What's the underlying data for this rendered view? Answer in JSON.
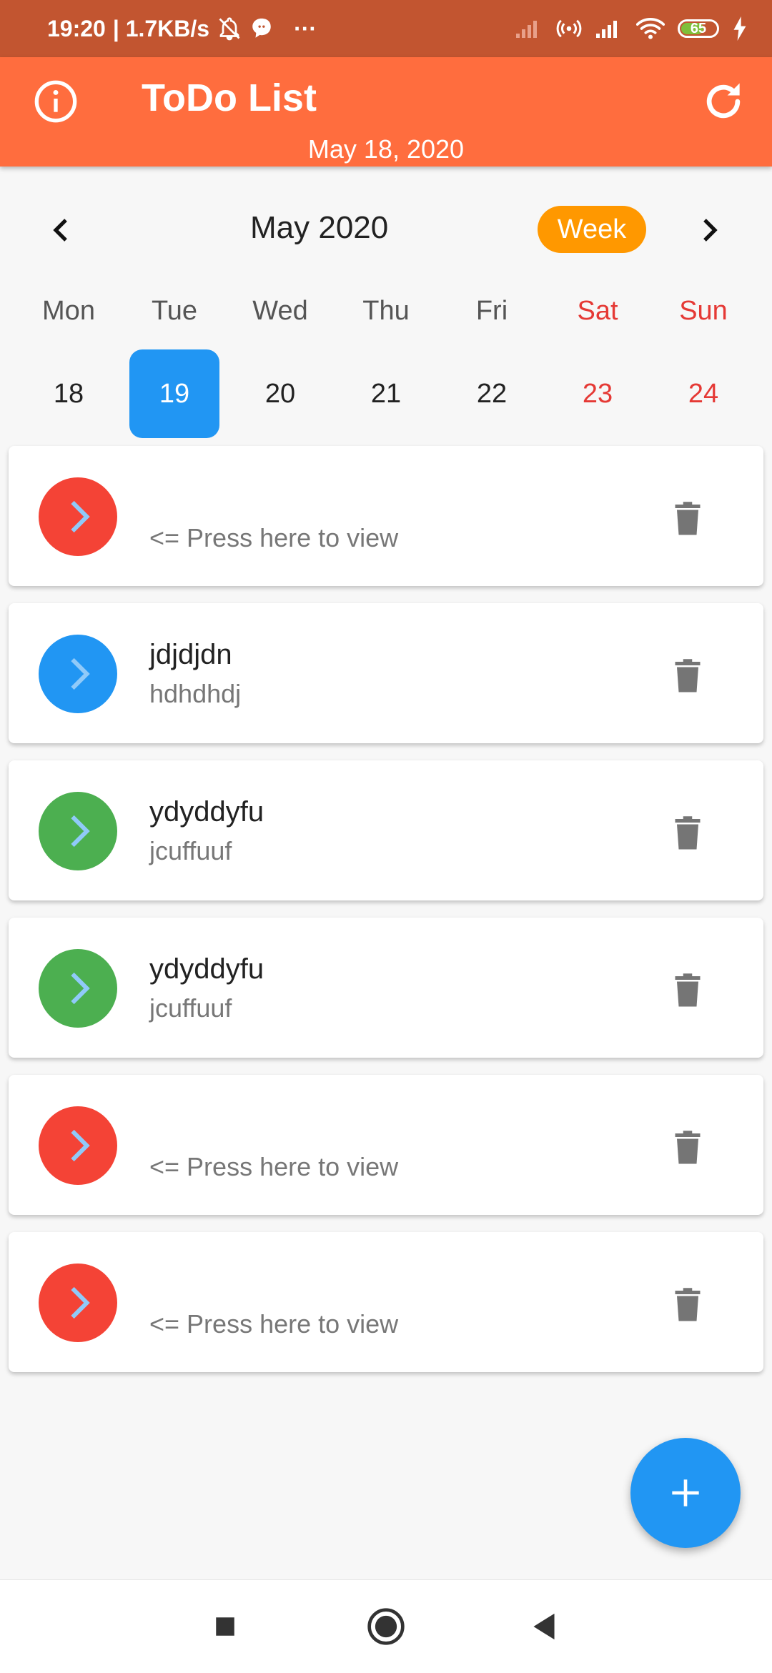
{
  "status_bar": {
    "time": "19:20",
    "net_speed": "| 1.7KB/s",
    "more": "···",
    "battery": "65"
  },
  "app_bar": {
    "title": "ToDo List",
    "date": "May 18, 2020"
  },
  "calendar": {
    "month": "May 2020",
    "view_toggle": "Week",
    "days": [
      {
        "name": "Mon",
        "num": "18"
      },
      {
        "name": "Tue",
        "num": "19",
        "selected": true
      },
      {
        "name": "Wed",
        "num": "20"
      },
      {
        "name": "Thu",
        "num": "21"
      },
      {
        "name": "Fri",
        "num": "22"
      },
      {
        "name": "Sat",
        "num": "23",
        "weekend": true
      },
      {
        "name": "Sun",
        "num": "24",
        "weekend": true
      }
    ]
  },
  "todos": [
    {
      "title": "",
      "subtitle": "<= Press here to view",
      "color": "#f44336"
    },
    {
      "title": "jdjdjdn",
      "subtitle": "hdhdhdj",
      "color": "#2196f3"
    },
    {
      "title": "ydyddyfu",
      "subtitle": "jcuffuuf",
      "color": "#4caf50"
    },
    {
      "title": "ydyddyfu",
      "subtitle": "jcuffuuf",
      "color": "#4caf50"
    },
    {
      "title": "",
      "subtitle": "<= Press here to view",
      "color": "#f44336"
    },
    {
      "title": "",
      "subtitle": "<= Press here to view",
      "color": "#f44336"
    }
  ],
  "colors": {
    "status_bar": "#c25530",
    "app_bar": "#ff6d3e",
    "accent_week": "#ff9800",
    "selected_day": "#2196f3",
    "fab": "#2196f3",
    "weekend": "#e53935"
  },
  "icons": {
    "info": "info-icon",
    "refresh": "refresh-icon",
    "prev": "chevron-left-icon",
    "next": "chevron-right-icon",
    "open": "chevron-right-icon",
    "delete": "trash-icon",
    "add": "plus-icon"
  }
}
